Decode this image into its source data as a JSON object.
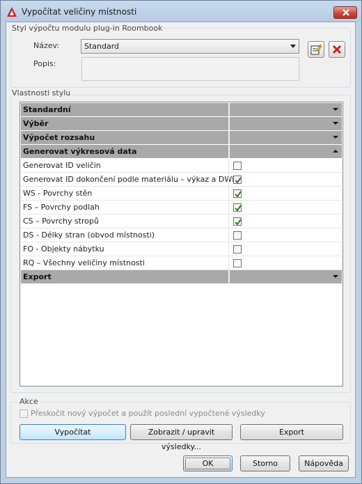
{
  "window": {
    "title": "Vypočítat veličiny místnosti"
  },
  "style_group": {
    "label": "Styl výpočtu modulu plug-in Roombook",
    "name_label": "Název:",
    "name_value": "Standard",
    "description_label": "Popis:",
    "description_value": ""
  },
  "properties": {
    "label": "Vlastnosti stylu",
    "categories": {
      "standard": "Standardní",
      "selection": "Výběr",
      "range": "Výpočet rozsahu",
      "generate": "Generovat výkresová data",
      "export": "Export"
    },
    "items": [
      {
        "label": "Generovat ID veličin",
        "checked": false
      },
      {
        "label": "Generovat ID dokončení podle materiálu – výkaz a DWF",
        "checked": true
      },
      {
        "label": "WS - Povrchy stěn",
        "checked": true
      },
      {
        "label": "FS – Povrchy podlah",
        "checked": true
      },
      {
        "label": "CS – Povrchy stropů",
        "checked": true
      },
      {
        "label": "DS - Délky stran (obvod místnosti)",
        "checked": false
      },
      {
        "label": "FO - Objekty nábytku",
        "checked": false
      },
      {
        "label": "RQ – Všechny veličiny místnosti",
        "checked": false
      }
    ]
  },
  "actions": {
    "label": "Akce",
    "skip_label": "Přeskočit nový výpočet a použít poslední vypočtené výsledky",
    "skip_checked": false,
    "calculate": "Vypočítat",
    "show_edit": "Zobrazit / upravit výsledky...",
    "export": "Export"
  },
  "footer": {
    "ok": "OK",
    "cancel": "Storno",
    "help": "Nápověda"
  },
  "colors": {
    "category_row": "#a9a9a9",
    "check": "#2d7d1f",
    "close_button": "#c4453a"
  }
}
